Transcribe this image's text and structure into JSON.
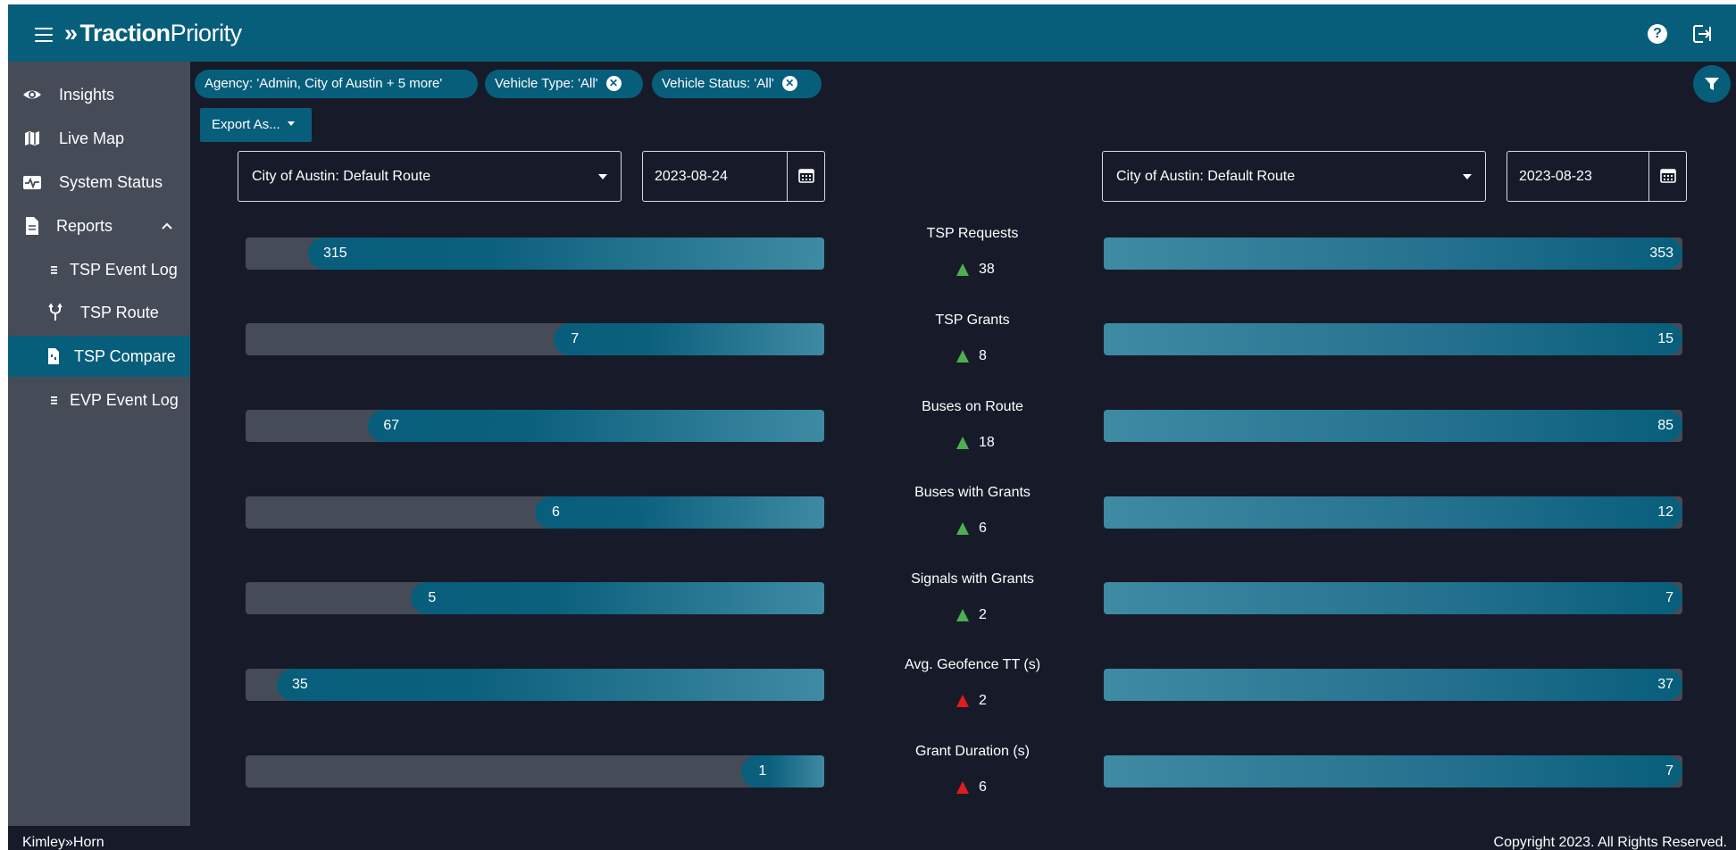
{
  "header": {
    "logo_word1": "Traction",
    "logo_word2": "Priority",
    "help_icon": "question-circle-icon",
    "logout_icon": "logout-icon"
  },
  "sidebar": {
    "items": [
      {
        "label": "Insights",
        "icon": "eye-icon"
      },
      {
        "label": "Live Map",
        "icon": "map-icon"
      },
      {
        "label": "System Status",
        "icon": "pulse-icon"
      },
      {
        "label": "Reports",
        "icon": "document-icon"
      },
      {
        "label": "TSP Event Log",
        "icon": "list-icon"
      },
      {
        "label": "TSP Route",
        "icon": "route-fork-icon"
      },
      {
        "label": "TSP Compare",
        "icon": "compare-document-icon"
      },
      {
        "label": "EVP Event Log",
        "icon": "list-icon"
      }
    ],
    "active": "TSP Compare"
  },
  "filters": {
    "agency_chip": "Agency: 'Admin, City of Austin + 5 more'",
    "vehicle_type_chip": "Vehicle Type: 'All'",
    "vehicle_status_chip": "Vehicle Status: 'All'",
    "export_label": "Export As..."
  },
  "left": {
    "route": "City of Austin: Default Route",
    "date": "2023-08-24"
  },
  "right": {
    "route": "City of Austin: Default Route",
    "date": "2023-08-23"
  },
  "metrics": [
    {
      "name": "TSP Requests",
      "left": "315",
      "right": "353",
      "delta": "38",
      "trend": "up",
      "status": "good",
      "left_ratio": 0.892
    },
    {
      "name": "TSP Grants",
      "left": "7",
      "right": "15",
      "delta": "8",
      "trend": "up",
      "status": "good",
      "left_ratio": 0.467
    },
    {
      "name": "Buses on Route",
      "left": "67",
      "right": "85",
      "delta": "18",
      "trend": "up",
      "status": "good",
      "left_ratio": 0.788
    },
    {
      "name": "Buses with Grants",
      "left": "6",
      "right": "12",
      "delta": "6",
      "trend": "up",
      "status": "good",
      "left_ratio": 0.5
    },
    {
      "name": "Signals with Grants",
      "left": "5",
      "right": "7",
      "delta": "2",
      "trend": "up",
      "status": "good",
      "left_ratio": 0.714
    },
    {
      "name": "Avg. Geofence TT (s)",
      "left": "35",
      "right": "37",
      "delta": "2",
      "trend": "up",
      "status": "bad",
      "left_ratio": 0.946
    },
    {
      "name": "Grant Duration (s)",
      "left": "1",
      "right": "7",
      "delta": "6",
      "trend": "up",
      "status": "bad",
      "left_ratio": 0.143
    }
  ],
  "colors": {
    "brand": "#075e7b",
    "good": "#4caf50",
    "bad": "#e31b1b"
  },
  "footer": {
    "company": "Kimley»Horn",
    "copyright": "Copyright 2023. All Rights Reserved."
  }
}
